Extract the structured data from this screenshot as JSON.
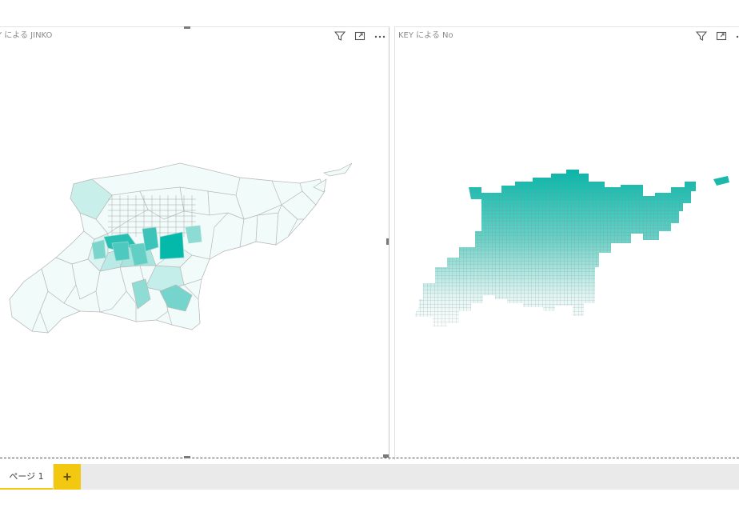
{
  "left_visual": {
    "title": "Y による JINKO",
    "fill_color_low": "#f2fbfa",
    "fill_color_high": "#01b8aa",
    "icons": [
      "filter-icon",
      "focus-mode-icon",
      "more-options-icon"
    ]
  },
  "right_visual": {
    "title": "KEY による No",
    "fill_color_low": "#ffffff",
    "fill_color_high": "#01b8aa",
    "icons": [
      "filter-icon",
      "focus-mode-icon",
      "more-options-icon"
    ]
  },
  "tabs": [
    {
      "label": "ページ 1",
      "active": true
    }
  ],
  "add_page": {
    "label": "+",
    "color": "#f2c811"
  },
  "colors": {
    "accent": "#f2c811",
    "map_teal": "#01b8aa"
  }
}
